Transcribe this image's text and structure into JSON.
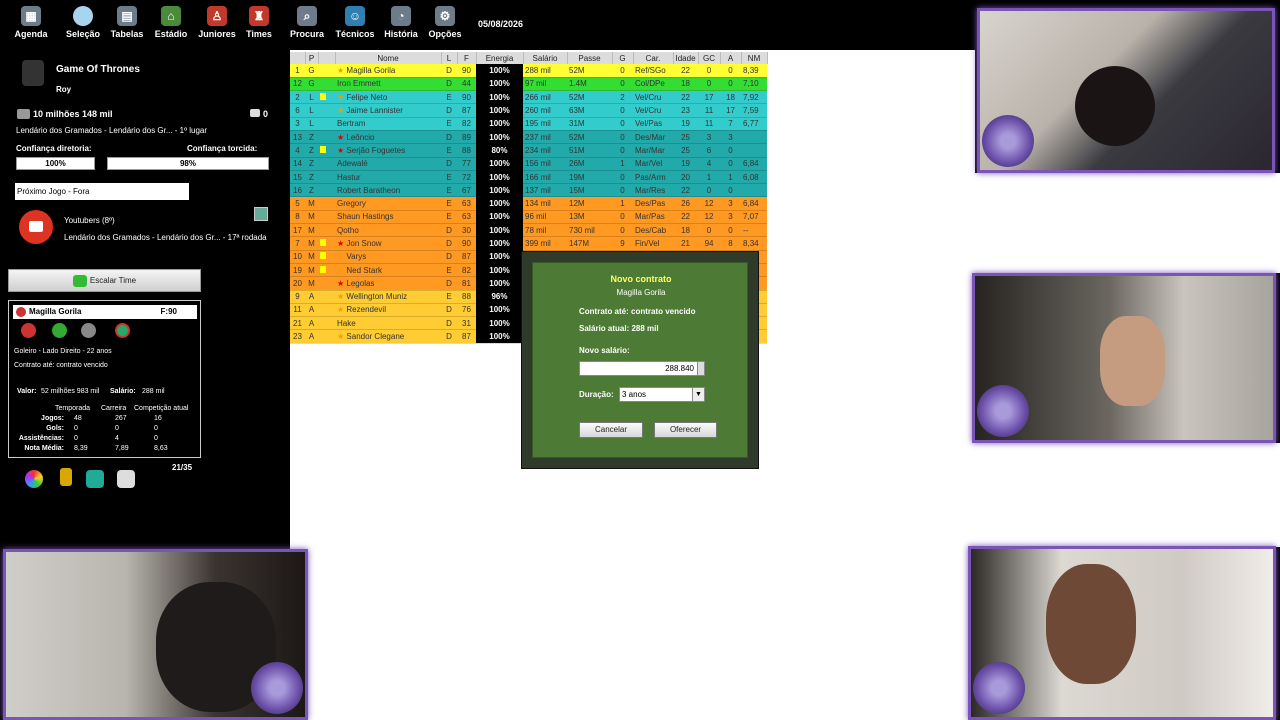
{
  "nav": {
    "items": [
      {
        "label": "Agenda",
        "icon": "calendar-icon"
      },
      {
        "label": "Seleção",
        "icon": "globe-icon"
      },
      {
        "label": "Tabelas",
        "icon": "table-icon"
      },
      {
        "label": "Estádio",
        "icon": "stadium-icon"
      },
      {
        "label": "Juniores",
        "icon": "junior-player-icon"
      },
      {
        "label": "Times",
        "icon": "shirt-icon"
      },
      {
        "label": "Procura",
        "icon": "search-icon"
      },
      {
        "label": "Técnicos",
        "icon": "coach-icon"
      },
      {
        "label": "História",
        "icon": "history-icon"
      },
      {
        "label": "Opções",
        "icon": "gear-icon"
      }
    ],
    "date": "05/08/2026"
  },
  "club": {
    "name": "Game Of Thrones",
    "manager": "Roy",
    "money": "10 milhões 148 mil",
    "messages": "0",
    "league_line": "Lendário dos Gramados - Lendário dos Gr... - 1º lugar",
    "conf_dir_label": "Confiança diretoria:",
    "conf_dir": "100%",
    "conf_tor_label": "Confiança torcida:",
    "conf_tor": "98%",
    "next_game": "Próximo Jogo - Fora",
    "opponent": "Youtubers (8º)",
    "opponent_line": "Lendário dos Gramados - Lendário dos Gr... - 17ª rodada",
    "escalar": "Escalar Time"
  },
  "player_card": {
    "name": "Magilla Gorila",
    "force": "F:90",
    "desc": "Goleiro - Lado Direito - 22 anos",
    "contract": "Contrato até: contrato vencido",
    "value_label": "Valor:",
    "value": "52 milhões 983 mil",
    "salary_label": "Salário:",
    "salary": "288 mil",
    "cols": [
      "Temporada",
      "Carreira",
      "Competição atual"
    ],
    "rows": [
      {
        "label": "Jogos:",
        "v": [
          "48",
          "267",
          "16"
        ]
      },
      {
        "label": "Gols:",
        "v": [
          "0",
          "0",
          "0"
        ]
      },
      {
        "label": "Assistências:",
        "v": [
          "0",
          "4",
          "0"
        ]
      },
      {
        "label": "Nota Média:",
        "v": [
          "8,39",
          "7,89",
          "8,63"
        ]
      }
    ],
    "count": "21/35"
  },
  "table": {
    "headers": [
      "",
      "P",
      "",
      "Nome",
      "L",
      "F",
      "Energia",
      "Salário",
      "Passe",
      "G",
      "Car.",
      "Idade",
      "GC",
      "A",
      "NM"
    ],
    "rows": [
      {
        "n": "1",
        "p": "G",
        "nome": "Magilla Gorila",
        "l": "D",
        "f": "90",
        "e": "100%",
        "sal": "288 mil",
        "passe": "52M",
        "g": "0",
        "car": "Ref/SGo",
        "id": "22",
        "gc": "0",
        "a": "0",
        "nm": "8,39",
        "bg": "#ffff33",
        "mark": "star"
      },
      {
        "n": "12",
        "p": "G",
        "nome": "Iron Emmett",
        "l": "D",
        "f": "44",
        "e": "100%",
        "sal": "97 mil",
        "passe": "1.4M",
        "g": "0",
        "car": "Col/DPe",
        "id": "18",
        "gc": "0",
        "a": "0",
        "nm": "7,10",
        "bg": "#33dd33",
        "mark": ""
      },
      {
        "n": "2",
        "p": "L",
        "nome": "Felipe Neto",
        "l": "E",
        "f": "90",
        "e": "100%",
        "sal": "266 mil",
        "passe": "52M",
        "g": "2",
        "car": "Vel/Cru",
        "id": "22",
        "gc": "17",
        "a": "18",
        "nm": "7,92",
        "bg": "#33cccc",
        "mark": "star"
      },
      {
        "n": "6",
        "p": "L",
        "nome": "Jaime Lannister",
        "l": "D",
        "f": "87",
        "e": "100%",
        "sal": "260 mil",
        "passe": "63M",
        "g": "0",
        "car": "Vel/Cru",
        "id": "23",
        "gc": "11",
        "a": "17",
        "nm": "7,59",
        "bg": "#33cccc",
        "mark": "star"
      },
      {
        "n": "3",
        "p": "L",
        "nome": "Bertram",
        "l": "E",
        "f": "82",
        "e": "100%",
        "sal": "195 mil",
        "passe": "31M",
        "g": "0",
        "car": "Vel/Pas",
        "id": "19",
        "gc": "11",
        "a": "7",
        "nm": "6,77",
        "bg": "#33cccc",
        "mark": ""
      },
      {
        "n": "13",
        "p": "Z",
        "nome": "Leôncio",
        "l": "D",
        "f": "89",
        "e": "100%",
        "sal": "237 mil",
        "passe": "52M",
        "g": "0",
        "car": "Des/Mar",
        "id": "25",
        "gc": "3",
        "a": "3",
        "nm": "",
        "bg": "#22aaaa",
        "mark": "rstar"
      },
      {
        "n": "4",
        "p": "Z",
        "nome": "Serjão Foguetes",
        "l": "E",
        "f": "88",
        "e": "80%",
        "sal": "234 mil",
        "passe": "51M",
        "g": "0",
        "car": "Mar/Mar",
        "id": "25",
        "gc": "6",
        "a": "0",
        "nm": "",
        "bg": "#22aaaa",
        "mark": "rstar"
      },
      {
        "n": "14",
        "p": "Z",
        "nome": "Adewalé",
        "l": "D",
        "f": "77",
        "e": "100%",
        "sal": "156 mil",
        "passe": "26M",
        "g": "1",
        "car": "Mar/Vel",
        "id": "19",
        "gc": "4",
        "a": "0",
        "nm": "6,84",
        "bg": "#22aaaa",
        "mark": ""
      },
      {
        "n": "15",
        "p": "Z",
        "nome": "Hastur",
        "l": "E",
        "f": "72",
        "e": "100%",
        "sal": "166 mil",
        "passe": "19M",
        "g": "0",
        "car": "Pas/Arm",
        "id": "20",
        "gc": "1",
        "a": "1",
        "nm": "6,08",
        "bg": "#22aaaa",
        "mark": ""
      },
      {
        "n": "16",
        "p": "Z",
        "nome": "Robert Baratheon",
        "l": "E",
        "f": "67",
        "e": "100%",
        "sal": "137 mil",
        "passe": "15M",
        "g": "0",
        "car": "Mar/Res",
        "id": "22",
        "gc": "0",
        "a": "0",
        "nm": "",
        "bg": "#22aaaa",
        "mark": ""
      },
      {
        "n": "5",
        "p": "M",
        "nome": "Gregory",
        "l": "E",
        "f": "63",
        "e": "100%",
        "sal": "134 mil",
        "passe": "12M",
        "g": "1",
        "car": "Des/Pas",
        "id": "26",
        "gc": "12",
        "a": "3",
        "nm": "6,84",
        "bg": "#ff9922",
        "mark": ""
      },
      {
        "n": "8",
        "p": "M",
        "nome": "Shaun Hastings",
        "l": "E",
        "f": "63",
        "e": "100%",
        "sal": "96 mil",
        "passe": "13M",
        "g": "0",
        "car": "Mar/Pas",
        "id": "22",
        "gc": "12",
        "a": "3",
        "nm": "7,07",
        "bg": "#ff9922",
        "mark": ""
      },
      {
        "n": "17",
        "p": "M",
        "nome": "Qotho",
        "l": "D",
        "f": "30",
        "e": "100%",
        "sal": "78 mil",
        "passe": "730 mil",
        "g": "0",
        "car": "Des/Cab",
        "id": "18",
        "gc": "0",
        "a": "0",
        "nm": "--",
        "bg": "#ff9922",
        "mark": ""
      },
      {
        "n": "7",
        "p": "M",
        "nome": "Jon Snow",
        "l": "D",
        "f": "90",
        "e": "100%",
        "sal": "399 mil",
        "passe": "147M",
        "g": "9",
        "car": "Fin/Vel",
        "id": "21",
        "gc": "94",
        "a": "8",
        "nm": "8,34",
        "bg": "#ff9922",
        "mark": "rstar"
      },
      {
        "n": "10",
        "p": "M",
        "nome": "Varys",
        "l": "D",
        "f": "87",
        "e": "100%",
        "sal": "",
        "passe": "",
        "g": "",
        "car": "",
        "id": "",
        "gc": "",
        "a": "",
        "nm": "",
        "bg": "#ff9922",
        "mark": "star"
      },
      {
        "n": "19",
        "p": "M",
        "nome": "Ned Stark",
        "l": "E",
        "f": "82",
        "e": "100%",
        "sal": "",
        "passe": "",
        "g": "",
        "car": "",
        "id": "",
        "gc": "",
        "a": "",
        "nm": "",
        "bg": "#ff9922",
        "mark": "star"
      },
      {
        "n": "20",
        "p": "M",
        "nome": "Legolas",
        "l": "D",
        "f": "81",
        "e": "100%",
        "sal": "",
        "passe": "",
        "g": "",
        "car": "",
        "id": "",
        "gc": "",
        "a": "",
        "nm": "",
        "bg": "#ff9922",
        "mark": "rstar"
      },
      {
        "n": "9",
        "p": "A",
        "nome": "Wellington Muniz",
        "l": "E",
        "f": "88",
        "e": "96%",
        "sal": "",
        "passe": "",
        "g": "",
        "car": "",
        "id": "",
        "gc": "",
        "a": "",
        "nm": "",
        "bg": "#ffcc33",
        "mark": "star"
      },
      {
        "n": "11",
        "p": "A",
        "nome": "Rezendevil",
        "l": "D",
        "f": "76",
        "e": "100%",
        "sal": "",
        "passe": "",
        "g": "",
        "car": "",
        "id": "",
        "gc": "",
        "a": "",
        "nm": "",
        "bg": "#ffcc33",
        "mark": "star"
      },
      {
        "n": "21",
        "p": "A",
        "nome": "Hake",
        "l": "D",
        "f": "31",
        "e": "100%",
        "sal": "",
        "passe": "",
        "g": "",
        "car": "",
        "id": "",
        "gc": "",
        "a": "",
        "nm": "",
        "bg": "#ffcc33",
        "mark": ""
      },
      {
        "n": "23",
        "p": "A",
        "nome": "Sandor Clegane",
        "l": "D",
        "f": "87",
        "e": "100%",
        "sal": "",
        "passe": "",
        "g": "",
        "car": "",
        "id": "",
        "gc": "",
        "a": "",
        "nm": "",
        "bg": "#ffcc33",
        "mark": "star"
      }
    ]
  },
  "dialog": {
    "title": "Novo contrato",
    "player": "Magilla Gorila",
    "contract": "Contrato até: contrato vencido",
    "current_salary": "Salário atual: 288 mil",
    "new_salary_label": "Novo salário:",
    "new_salary": "288.840",
    "duration_label": "Duração:",
    "duration": "3 anos",
    "cancel": "Cancelar",
    "offer": "Oferecer"
  }
}
